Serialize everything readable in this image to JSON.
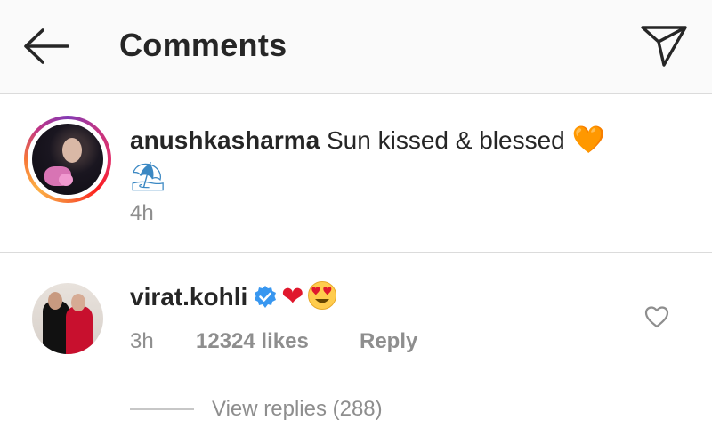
{
  "header": {
    "title": "Comments",
    "back_icon": "arrow-left-icon",
    "send_icon": "paper-plane-icon"
  },
  "caption": {
    "username": "anushkasharma",
    "text": "Sun kissed & blessed",
    "emoji_heart": "🧡",
    "emoji_beach": "⛱",
    "time": "4h",
    "avatar_ring_colors": [
      "#833ab4",
      "#e1306c",
      "#fd1d1d",
      "#fcaf45"
    ]
  },
  "reply": {
    "username": "virat.kohli",
    "verified_icon": "verified-badge-icon",
    "emoji_heart": "❤",
    "emoji_face": "heart-eyes-emoji",
    "time": "3h",
    "likes": "12324 likes",
    "reply_label": "Reply",
    "like_icon": "heart-outline-icon",
    "view_replies": "View replies (288)"
  },
  "colors": {
    "text_primary": "#262626",
    "text_secondary": "#8e8e8e",
    "verified_blue": "#3897f0",
    "divider": "#dbdbdb"
  }
}
